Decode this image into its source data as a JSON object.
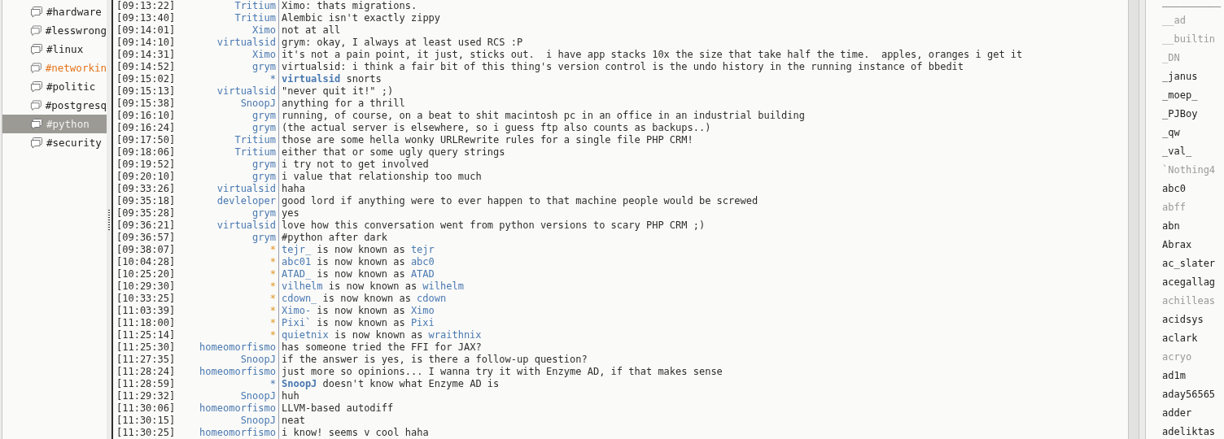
{
  "channels": [
    {
      "name": "#hardware",
      "selected": false,
      "highlighted": false
    },
    {
      "name": "#lesswrong",
      "selected": false,
      "highlighted": false
    },
    {
      "name": "#linux",
      "selected": false,
      "highlighted": false
    },
    {
      "name": "#networkin",
      "selected": false,
      "highlighted": true
    },
    {
      "name": "#politic",
      "selected": false,
      "highlighted": false
    },
    {
      "name": "#postgresq",
      "selected": false,
      "highlighted": false
    },
    {
      "name": "#python",
      "selected": true,
      "highlighted": false
    },
    {
      "name": "#security",
      "selected": false,
      "highlighted": false
    }
  ],
  "messages": [
    {
      "kind": "message",
      "time": "[09:13:22]",
      "nick": "Tritium",
      "text": "Ximo: thats migrations."
    },
    {
      "kind": "message",
      "time": "[09:13:40]",
      "nick": "Tritium",
      "text": "Alembic isn't exactly zippy"
    },
    {
      "kind": "message",
      "time": "[09:14:01]",
      "nick": "Ximo",
      "text": "not at all"
    },
    {
      "kind": "message",
      "time": "[09:14:10]",
      "nick": "virtualsid",
      "text": "grym: okay, I always at least used RCS :P"
    },
    {
      "kind": "message",
      "time": "[09:14:31]",
      "nick": "Ximo",
      "text": "it's not a pain point, it just, sticks out.  i have app stacks 10x the size that take half the time.  apples, oranges i get it"
    },
    {
      "kind": "message",
      "time": "[09:14:52]",
      "nick": "grym",
      "text": "virtualsid: i think a fair bit of this thing's version control is the undo history in the running instance of bbedit"
    },
    {
      "kind": "action",
      "time": "[09:15:02]",
      "marker": "*",
      "actor": "virtualsid",
      "text": "snorts"
    },
    {
      "kind": "message",
      "time": "[09:15:13]",
      "nick": "virtualsid",
      "text": "\"never quit it!\" ;)"
    },
    {
      "kind": "message",
      "time": "[09:15:38]",
      "nick": "SnoopJ",
      "text": "anything for a thrill"
    },
    {
      "kind": "message",
      "time": "[09:16:10]",
      "nick": "grym",
      "text": "running, of course, on a beat to shit macintosh pc in an office in an industrial building"
    },
    {
      "kind": "message",
      "time": "[09:16:24]",
      "nick": "grym",
      "text": "(the actual server is elsewhere, so i guess ftp also counts as backups..)"
    },
    {
      "kind": "message",
      "time": "[09:17:50]",
      "nick": "Tritium",
      "text": "those are some hella wonky URLRewrite rules for a single file PHP CRM!"
    },
    {
      "kind": "message",
      "time": "[09:18:06]",
      "nick": "Tritium",
      "text": "either that or some ugly query strings"
    },
    {
      "kind": "message",
      "time": "[09:19:52]",
      "nick": "grym",
      "text": "i try not to get involved"
    },
    {
      "kind": "message",
      "time": "[09:20:10]",
      "nick": "grym",
      "text": "i value that relationship too much"
    },
    {
      "kind": "message",
      "time": "[09:33:26]",
      "nick": "virtualsid",
      "text": "haha"
    },
    {
      "kind": "message",
      "time": "[09:35:18]",
      "nick": "devleloper",
      "text": "good lord if anything were to ever happen to that machine people would be screwed"
    },
    {
      "kind": "message",
      "time": "[09:35:28]",
      "nick": "grym",
      "text": "yes"
    },
    {
      "kind": "message",
      "time": "[09:36:21]",
      "nick": "virtualsid",
      "text": "love how this conversation went from python versions to scary PHP CRM ;)"
    },
    {
      "kind": "message",
      "time": "[09:36:57]",
      "nick": "grym",
      "text": "#python after dark"
    },
    {
      "kind": "nick_change",
      "time": "[09:38:07]",
      "marker": "*",
      "old": "tejr_",
      "text": "is now known as",
      "new": "tejr"
    },
    {
      "kind": "nick_change",
      "time": "[10:04:28]",
      "marker": "*",
      "old": "abc01",
      "text": "is now known as",
      "new": "abc0"
    },
    {
      "kind": "nick_change",
      "time": "[10:25:20]",
      "marker": "*",
      "old": "ATAD_",
      "text": "is now known as",
      "new": "ATAD"
    },
    {
      "kind": "nick_change",
      "time": "[10:29:30]",
      "marker": "*",
      "old": "vilhelm",
      "text": "is now known as",
      "new": "wilhelm"
    },
    {
      "kind": "nick_change",
      "time": "[10:33:25]",
      "marker": "*",
      "old": "cdown_",
      "text": "is now known as",
      "new": "cdown"
    },
    {
      "kind": "nick_change",
      "time": "[11:03:39]",
      "marker": "*",
      "old": "Ximo-",
      "text": "is now known as",
      "new": "Ximo"
    },
    {
      "kind": "nick_change",
      "time": "[11:18:00]",
      "marker": "*",
      "old": "Pixi`",
      "text": "is now known as",
      "new": "Pixi"
    },
    {
      "kind": "nick_change",
      "time": "[11:25:14]",
      "marker": "*",
      "old": "quietnix",
      "text": "is now known as",
      "new": "wraithnix"
    },
    {
      "kind": "message",
      "time": "[11:25:30]",
      "nick": "homeomorfismo",
      "text": "has someone tried the FFI for JAX?"
    },
    {
      "kind": "message",
      "time": "[11:27:35]",
      "nick": "SnoopJ",
      "text": "if the answer is yes, is there a follow-up question?"
    },
    {
      "kind": "message",
      "time": "[11:28:24]",
      "nick": "homeomorfismo",
      "text": "just more so opinions... I wanna try it with Enzyme AD, if that makes sense"
    },
    {
      "kind": "action",
      "time": "[11:28:59]",
      "marker": "*",
      "actor": "SnoopJ",
      "text": "doesn't know what Enzyme AD is"
    },
    {
      "kind": "message",
      "time": "[11:29:32]",
      "nick": "SnoopJ",
      "text": "huh"
    },
    {
      "kind": "message",
      "time": "[11:30:06]",
      "nick": "homeomorfismo",
      "text": "LLVM-based autodiff"
    },
    {
      "kind": "message",
      "time": "[11:30:15]",
      "nick": "SnoopJ",
      "text": "neat"
    },
    {
      "kind": "message",
      "time": "[11:30:25]",
      "nick": "homeomorfismo",
      "text": "i know! seems v cool haha"
    }
  ],
  "users": [
    {
      "name": "__________",
      "away": false
    },
    {
      "name": "__ad",
      "away": true
    },
    {
      "name": "__builtin",
      "away": true
    },
    {
      "name": "_DN",
      "away": true
    },
    {
      "name": "_janus",
      "away": false
    },
    {
      "name": "_moep_",
      "away": false
    },
    {
      "name": "_PJBoy",
      "away": false
    },
    {
      "name": "_qw",
      "away": false
    },
    {
      "name": "_val_",
      "away": false
    },
    {
      "name": "`Nothing4",
      "away": true
    },
    {
      "name": "abc0",
      "away": false
    },
    {
      "name": "abff",
      "away": true
    },
    {
      "name": "abn",
      "away": false
    },
    {
      "name": "Abrax",
      "away": false
    },
    {
      "name": "ac_slater",
      "away": false
    },
    {
      "name": "acegallag",
      "away": false
    },
    {
      "name": "achilleas",
      "away": true
    },
    {
      "name": "acidsys",
      "away": false
    },
    {
      "name": "aclark",
      "away": false
    },
    {
      "name": "acryo",
      "away": true
    },
    {
      "name": "ad1m",
      "away": false
    },
    {
      "name": "aday56565",
      "away": false
    },
    {
      "name": "adder",
      "away": false
    },
    {
      "name": "adeliktas",
      "away": false
    }
  ]
}
